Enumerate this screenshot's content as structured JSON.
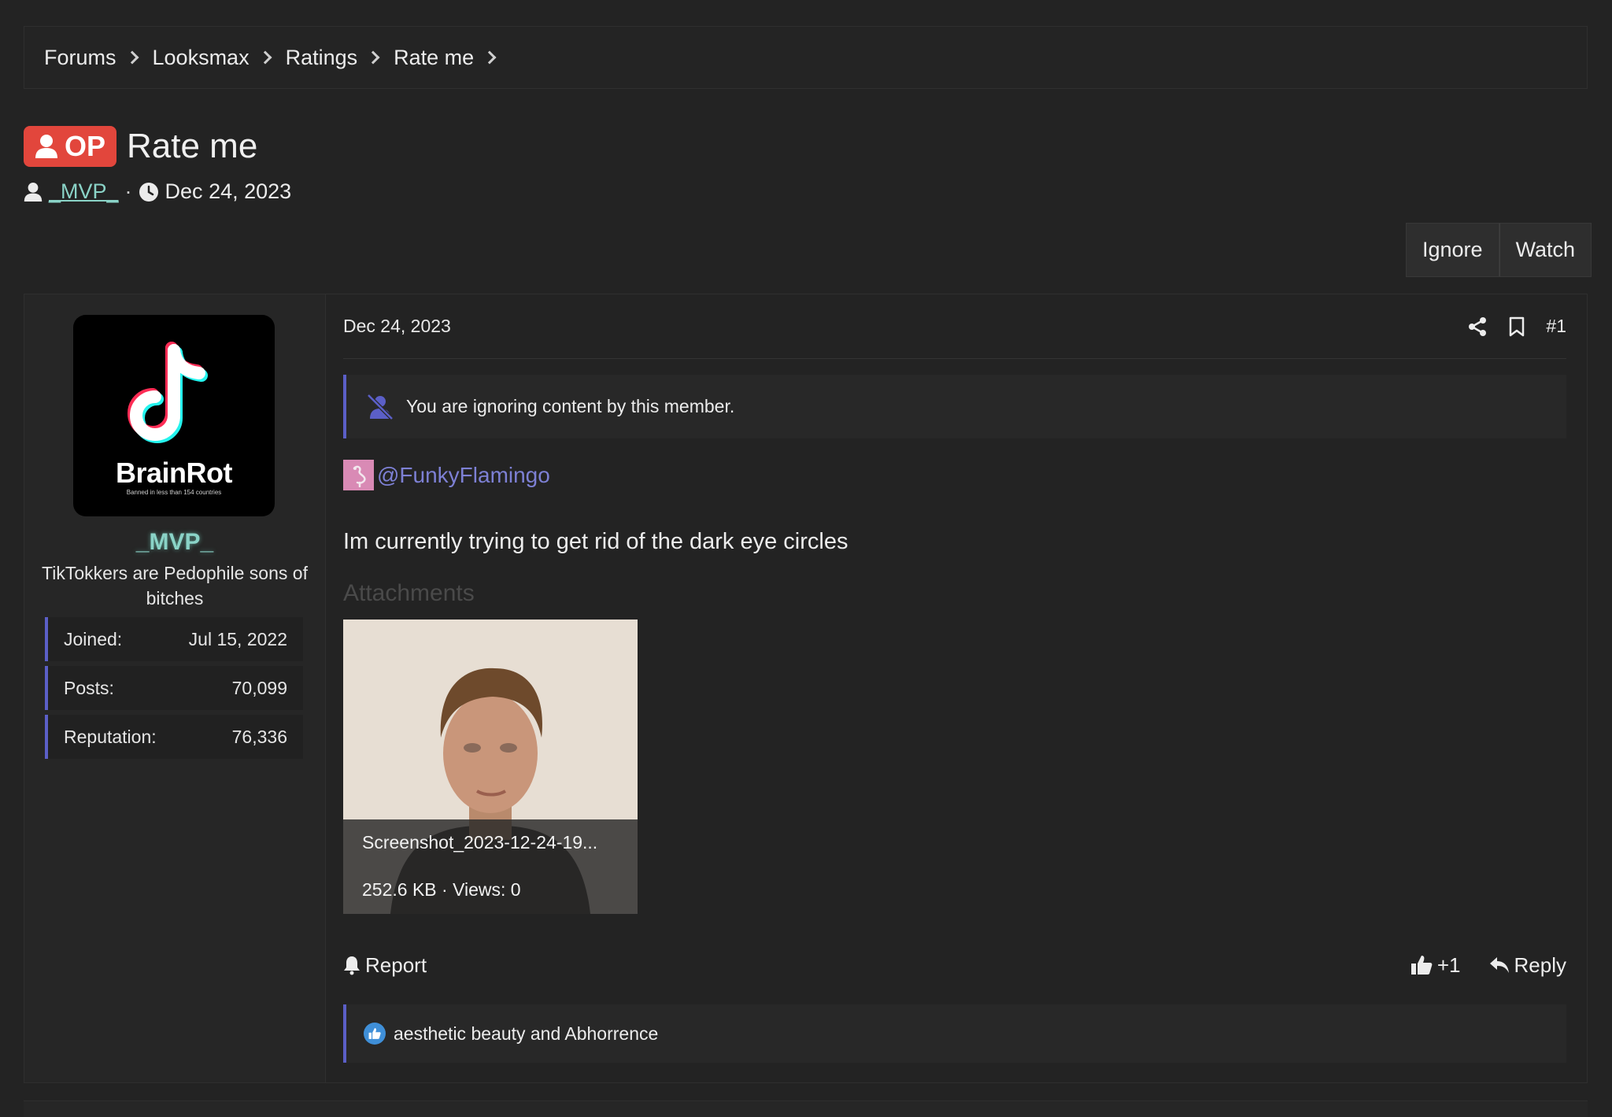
{
  "breadcrumb": [
    "Forums",
    "Looksmax",
    "Ratings",
    "Rate me"
  ],
  "thread": {
    "badge": "OP",
    "title": "Rate me",
    "author": "_MVP_",
    "separator": "·",
    "date": "Dec 24, 2023"
  },
  "actions": {
    "ignore": "Ignore",
    "watch": "Watch"
  },
  "user": {
    "avatar_brand": "BrainRot",
    "avatar_sub": "Banned in less than 154 countries",
    "name": "_MVP_",
    "title": "TikTokkers are Pedophile sons of bitches",
    "stats": [
      {
        "label": "Joined:",
        "value": "Jul 15, 2022"
      },
      {
        "label": "Posts:",
        "value": "70,099"
      },
      {
        "label": "Reputation:",
        "value": "76,336"
      }
    ]
  },
  "post": {
    "date": "Dec 24, 2023",
    "number": "#1",
    "ignore_notice": "You are ignoring content by this member.",
    "mention": "@FunkyFlamingo",
    "body": "Im currently trying to get rid of the dark eye circles",
    "attachments_label": "Attachments",
    "attachment": {
      "name": "Screenshot_2023-12-24-19...",
      "meta": "252.6 KB · Views: 0"
    },
    "report": "Report",
    "like_count": "+1",
    "reply": "Reply",
    "likes_text": "aesthetic beauty and Abhorrence"
  },
  "colors": {
    "accent": "#5b5fc7",
    "op_badge": "#e2463c",
    "username": "#8ad3c7",
    "mention": "#7d80d4"
  }
}
